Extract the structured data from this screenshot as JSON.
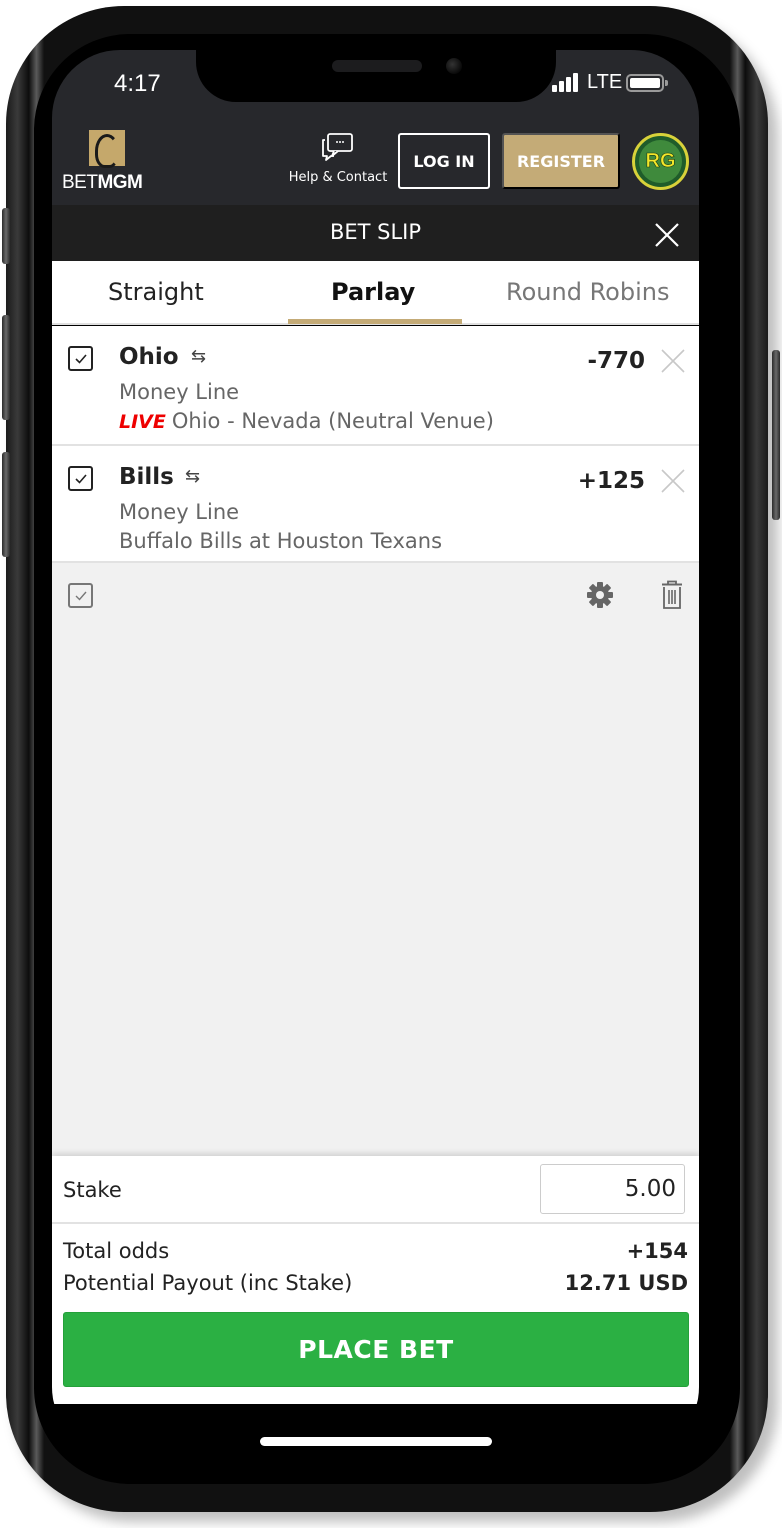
{
  "status_bar": {
    "time": "4:17",
    "network": "LTE",
    "signal_bars": 4,
    "battery_level": "full"
  },
  "header": {
    "logo_text_light": "BET",
    "logo_text_bold": "MGM",
    "help_label": "Help & Contact",
    "help_icon": "chat-bubbles-icon",
    "login_label": "LOG IN",
    "register_label": "REGISTER",
    "rg_badge": "RG"
  },
  "bet_slip": {
    "title": "BET SLIP",
    "close_icon": "close-icon"
  },
  "tabs": [
    {
      "label": "Straight",
      "active": false
    },
    {
      "label": "Parlay",
      "active": true
    },
    {
      "label": "Round Robins",
      "active": false
    }
  ],
  "selections": [
    {
      "name": "Ohio",
      "checked": true,
      "market": "Money Line",
      "live_label": "LIVE",
      "event": "Ohio - Nevada (Neutral Venue)",
      "odds": "-770"
    },
    {
      "name": "Bills",
      "checked": true,
      "market": "Money Line",
      "event": "Buffalo Bills at Houston Texans",
      "odds": "+125"
    }
  ],
  "toolbar": {
    "select_all_checked": true,
    "settings_icon": "gear-icon",
    "delete_icon": "trash-icon"
  },
  "summary": {
    "stake_label": "Stake",
    "stake_value": "5.00",
    "total_odds_label": "Total odds",
    "total_odds_value": "+154",
    "payout_label": "Potential Payout (inc Stake)",
    "payout_value": "12.71",
    "payout_currency": "USD",
    "place_bet_label": "PLACE BET"
  },
  "colors": {
    "brand_gold": "#c4ab77",
    "header_bg": "#27282c",
    "slip_bar_bg": "#1f1f1f",
    "place_bet_green": "#2bb043",
    "live_red": "#ee0000"
  }
}
